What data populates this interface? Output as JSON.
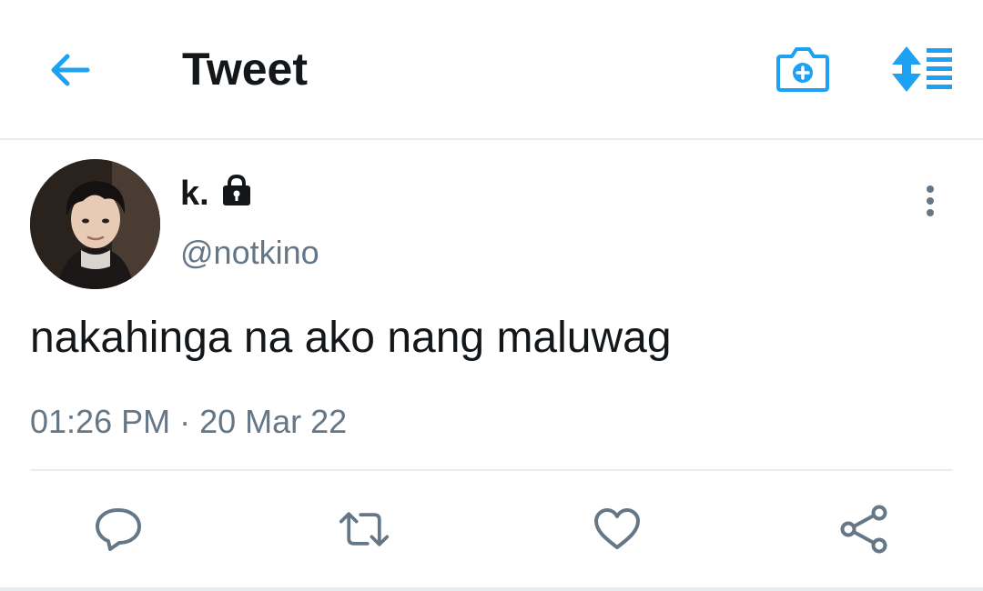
{
  "header": {
    "title": "Tweet",
    "back_icon": "arrow-left-icon",
    "camera_icon": "camera-plus-icon",
    "sort_icon": "sort-list-icon",
    "accent_color": "#1da1f2"
  },
  "tweet": {
    "author": {
      "display_name": "k.",
      "handle": "@notkino",
      "protected_icon": "lock-icon"
    },
    "text": "nakahinga na ako nang maluwag",
    "timestamp": "01:26 PM · 20 Mar 22",
    "more_icon": "vertical-dots-icon"
  },
  "actions": [
    {
      "name": "reply",
      "icon": "comment-icon"
    },
    {
      "name": "retweet",
      "icon": "retweet-icon"
    },
    {
      "name": "like",
      "icon": "heart-icon"
    },
    {
      "name": "share",
      "icon": "share-icon"
    }
  ],
  "colors": {
    "text_primary": "#14171a",
    "text_secondary": "#657786",
    "divider": "#e6ecf0",
    "icon_gray": "#657786"
  }
}
